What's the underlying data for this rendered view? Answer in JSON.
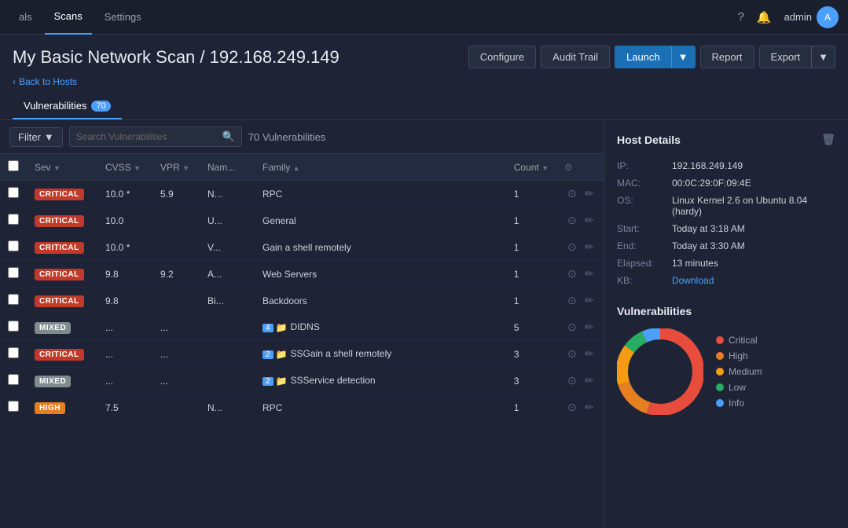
{
  "topnav": {
    "items": [
      {
        "label": "als",
        "active": false
      },
      {
        "label": "Scans",
        "active": true
      },
      {
        "label": "Settings",
        "active": false
      }
    ],
    "user": "admin",
    "icons": {
      "help": "?",
      "bell": "🔔"
    }
  },
  "page": {
    "title": "My Basic Network Scan / 192.168.249.149",
    "back_link": "Back to Hosts",
    "tab_label": "Vulnerabilities",
    "tab_count": "70"
  },
  "toolbar": {
    "configure": "Configure",
    "audit_trail": "Audit Trail",
    "launch": "Launch",
    "report": "Report",
    "export": "Export"
  },
  "filter": {
    "label": "Filter",
    "placeholder": "Search Vulnerabilities",
    "count": "70",
    "count_label": "Vulnerabilities"
  },
  "table": {
    "headers": [
      "",
      "Sev",
      "CVSS",
      "VPR",
      "Nam...",
      "Family",
      "Count",
      ""
    ],
    "sort_indicators": [
      "▼",
      "▼",
      "▼",
      "",
      "▲",
      "",
      "▼",
      ""
    ],
    "rows": [
      {
        "sev": "CRITICAL",
        "sev_class": "sev-critical",
        "cvss": "10.0 *",
        "vpr": "5.9",
        "name": "N...",
        "family": "RPC",
        "count": "1",
        "has_folder": false
      },
      {
        "sev": "CRITICAL",
        "sev_class": "sev-critical",
        "cvss": "10.0",
        "vpr": "",
        "name": "U...",
        "family": "General",
        "count": "1",
        "has_folder": false
      },
      {
        "sev": "CRITICAL",
        "sev_class": "sev-critical",
        "cvss": "10.0 *",
        "vpr": "",
        "name": "V...",
        "family": "Gain a shell remotely",
        "count": "1",
        "has_folder": false
      },
      {
        "sev": "CRITICAL",
        "sev_class": "sev-critical",
        "cvss": "9.8",
        "vpr": "9.2",
        "name": "A...",
        "family": "Web Servers",
        "count": "1",
        "has_folder": false
      },
      {
        "sev": "CRITICAL",
        "sev_class": "sev-critical",
        "cvss": "9.8",
        "vpr": "",
        "name": "Bi...",
        "family": "Backdoors",
        "count": "1",
        "has_folder": false
      },
      {
        "sev": "MIXED",
        "sev_class": "sev-mixed",
        "cvss": "...",
        "vpr": "...",
        "name": "",
        "family": "DIDNS",
        "count": "5",
        "has_folder": true,
        "folder_num": "4"
      },
      {
        "sev": "CRITICAL",
        "sev_class": "sev-critical",
        "cvss": "...",
        "vpr": "...",
        "name": "",
        "family": "SSGain a shell remotely",
        "count": "3",
        "has_folder": true,
        "folder_num": "2"
      },
      {
        "sev": "MIXED",
        "sev_class": "sev-mixed",
        "cvss": "...",
        "vpr": "...",
        "name": "",
        "family": "SSService detection",
        "count": "3",
        "has_folder": true,
        "folder_num": "2"
      },
      {
        "sev": "HIGH",
        "sev_class": "sev-high",
        "cvss": "7.5",
        "vpr": "",
        "name": "N...",
        "family": "RPC",
        "count": "1",
        "has_folder": false
      }
    ]
  },
  "host_details": {
    "title": "Host Details",
    "fields": [
      {
        "label": "IP:",
        "value": "192.168.249.149"
      },
      {
        "label": "MAC:",
        "value": "00:0C:29:0F:09:4E"
      },
      {
        "label": "OS:",
        "value": "Linux Kernel 2.6 on Ubuntu 8.04 (hardy)"
      },
      {
        "label": "Start:",
        "value": "Today at 3:18 AM"
      },
      {
        "label": "End:",
        "value": "Today at 3:30 AM"
      },
      {
        "label": "Elapsed:",
        "value": "13 minutes"
      },
      {
        "label": "KB:",
        "value": "Download",
        "is_link": true
      }
    ]
  },
  "vulnerabilities_chart": {
    "title": "Vulnerabilities",
    "legend": [
      {
        "label": "Critical",
        "color": "#e74c3c"
      },
      {
        "label": "High",
        "color": "#e67e22"
      },
      {
        "label": "Medium",
        "color": "#f39c12"
      },
      {
        "label": "Low",
        "color": "#27ae60"
      },
      {
        "label": "Info",
        "color": "#4a9fff"
      }
    ],
    "donut": {
      "segments": [
        {
          "value": 55,
          "color": "#e74c3c"
        },
        {
          "value": 15,
          "color": "#e67e22"
        },
        {
          "value": 15,
          "color": "#f39c12"
        },
        {
          "value": 8,
          "color": "#27ae60"
        },
        {
          "value": 7,
          "color": "#4a9fff"
        }
      ]
    }
  }
}
